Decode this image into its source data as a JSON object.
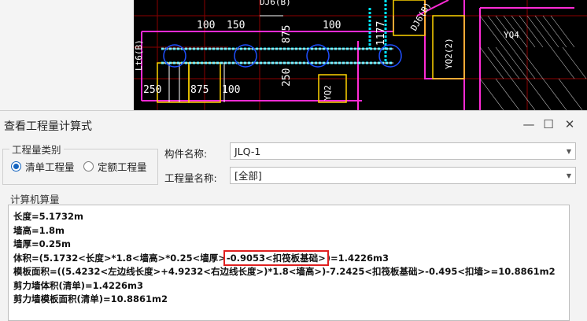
{
  "cad": {
    "dims": [
      "100",
      "150",
      "875",
      "250",
      "1177",
      "100",
      "250",
      "875",
      "100"
    ],
    "labels": [
      "YQ4",
      "YQ2(2)",
      "YQ2",
      "DJ6(B)",
      "DJ6(B)",
      "Lt6(B)"
    ]
  },
  "dialog": {
    "title": "查看工程量计算式",
    "controls": {
      "minimize": "—",
      "maximize": "☐",
      "close": "✕"
    },
    "category": {
      "title": "工程量类别",
      "options": [
        "清单工程量",
        "定额工程量"
      ],
      "selected": 0
    },
    "component": {
      "label": "构件名称:",
      "value": "JLQ-1"
    },
    "quantity": {
      "label": "工程量名称:",
      "value": "[全部]"
    },
    "calc": {
      "title": "计算机算量",
      "lines": [
        "长度=5.1732m",
        "墙高=1.8m",
        "墙厚=0.25m",
        "体积=(5.1732<长度>*1.8<墙高>*0.25<墙厚>",
        "-0.9053<扣筏板基础>",
        ")=1.4226m3",
        "模板面积=((5.4232<左边线长度>+4.9232<右边线长度>)*1.8<墙高>)-7.2425<扣筏板基础>-0.495<扣墙>=10.8861m2",
        "剪力墙体积(清单)=1.4226m3",
        "剪力墙模板面积(清单)=10.8861m2"
      ]
    }
  },
  "colors": {
    "accent": "#1565c0",
    "highlight": "#e02020",
    "cad_bg": "#000000",
    "cad_cyan": "#00e5ff",
    "cad_magenta": "#ff2bd6"
  }
}
